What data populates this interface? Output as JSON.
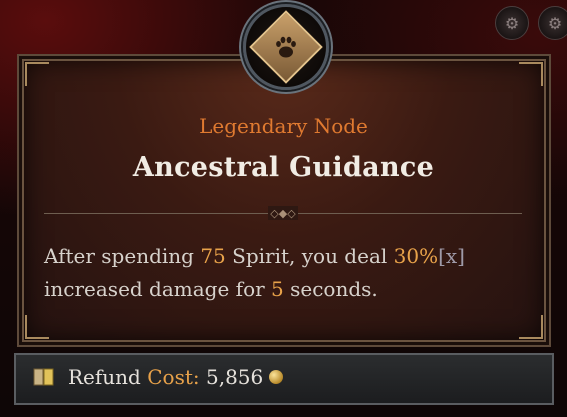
{
  "node": {
    "category": "Legendary Node",
    "name": "Ancestral Guidance",
    "icon": "bear-paw-icon"
  },
  "description": {
    "part1": "After spending ",
    "spirit_value": "75",
    "part2": " Spirit, you deal ",
    "damage_value": "30%",
    "multiplier_tag": "[x]",
    "part3": "increased damage for ",
    "duration_value": "5",
    "part4": " seconds."
  },
  "footer": {
    "refund_label": "Refund",
    "cost_label": "Cost:",
    "cost_value": "5,856",
    "currency_icon": "gold-coin-icon"
  },
  "colors": {
    "category": "#e07a30",
    "highlight": "#e8a24a",
    "title": "#f1ece4"
  }
}
